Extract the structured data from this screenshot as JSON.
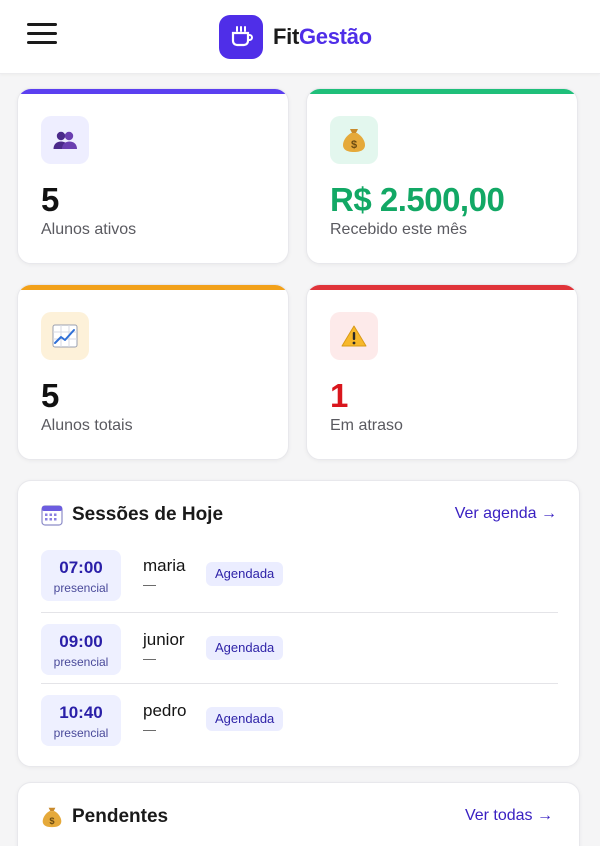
{
  "brand": {
    "name_part1": "Fit",
    "name_part2": "Gestão",
    "logo_icon": "coffee-cup-icon",
    "accent": "#4f2ee8"
  },
  "stats": [
    {
      "value": "5",
      "label": "Alunos ativos",
      "icon": "people-icon",
      "color": "#5b3ff0",
      "value_color": "#111111"
    },
    {
      "value": "R$ 2.500,00",
      "label": "Recebido este mês",
      "icon": "money-bag-icon",
      "color": "#1fbf7a",
      "value_color": "#12a865"
    },
    {
      "value": "5",
      "label": "Alunos totais",
      "icon": "chart-increasing-icon",
      "color": "#f2a11a",
      "value_color": "#111111"
    },
    {
      "value": "1",
      "label": "Em atraso",
      "icon": "warning-icon",
      "color": "#e0343a",
      "value_color": "#d9161d"
    }
  ],
  "sessions_panel": {
    "title": "Sessões de Hoje",
    "link": "Ver agenda →",
    "items": [
      {
        "time": "07:00",
        "mode": "presencial",
        "name": "maria",
        "detail": "—",
        "status": "Agendada"
      },
      {
        "time": "09:00",
        "mode": "presencial",
        "name": "junior",
        "detail": "—",
        "status": "Agendada"
      },
      {
        "time": "10:40",
        "mode": "presencial",
        "name": "pedro",
        "detail": "—",
        "status": "Agendada"
      }
    ]
  },
  "pending_panel": {
    "title": "Pendentes",
    "link": "Ver todas →"
  }
}
